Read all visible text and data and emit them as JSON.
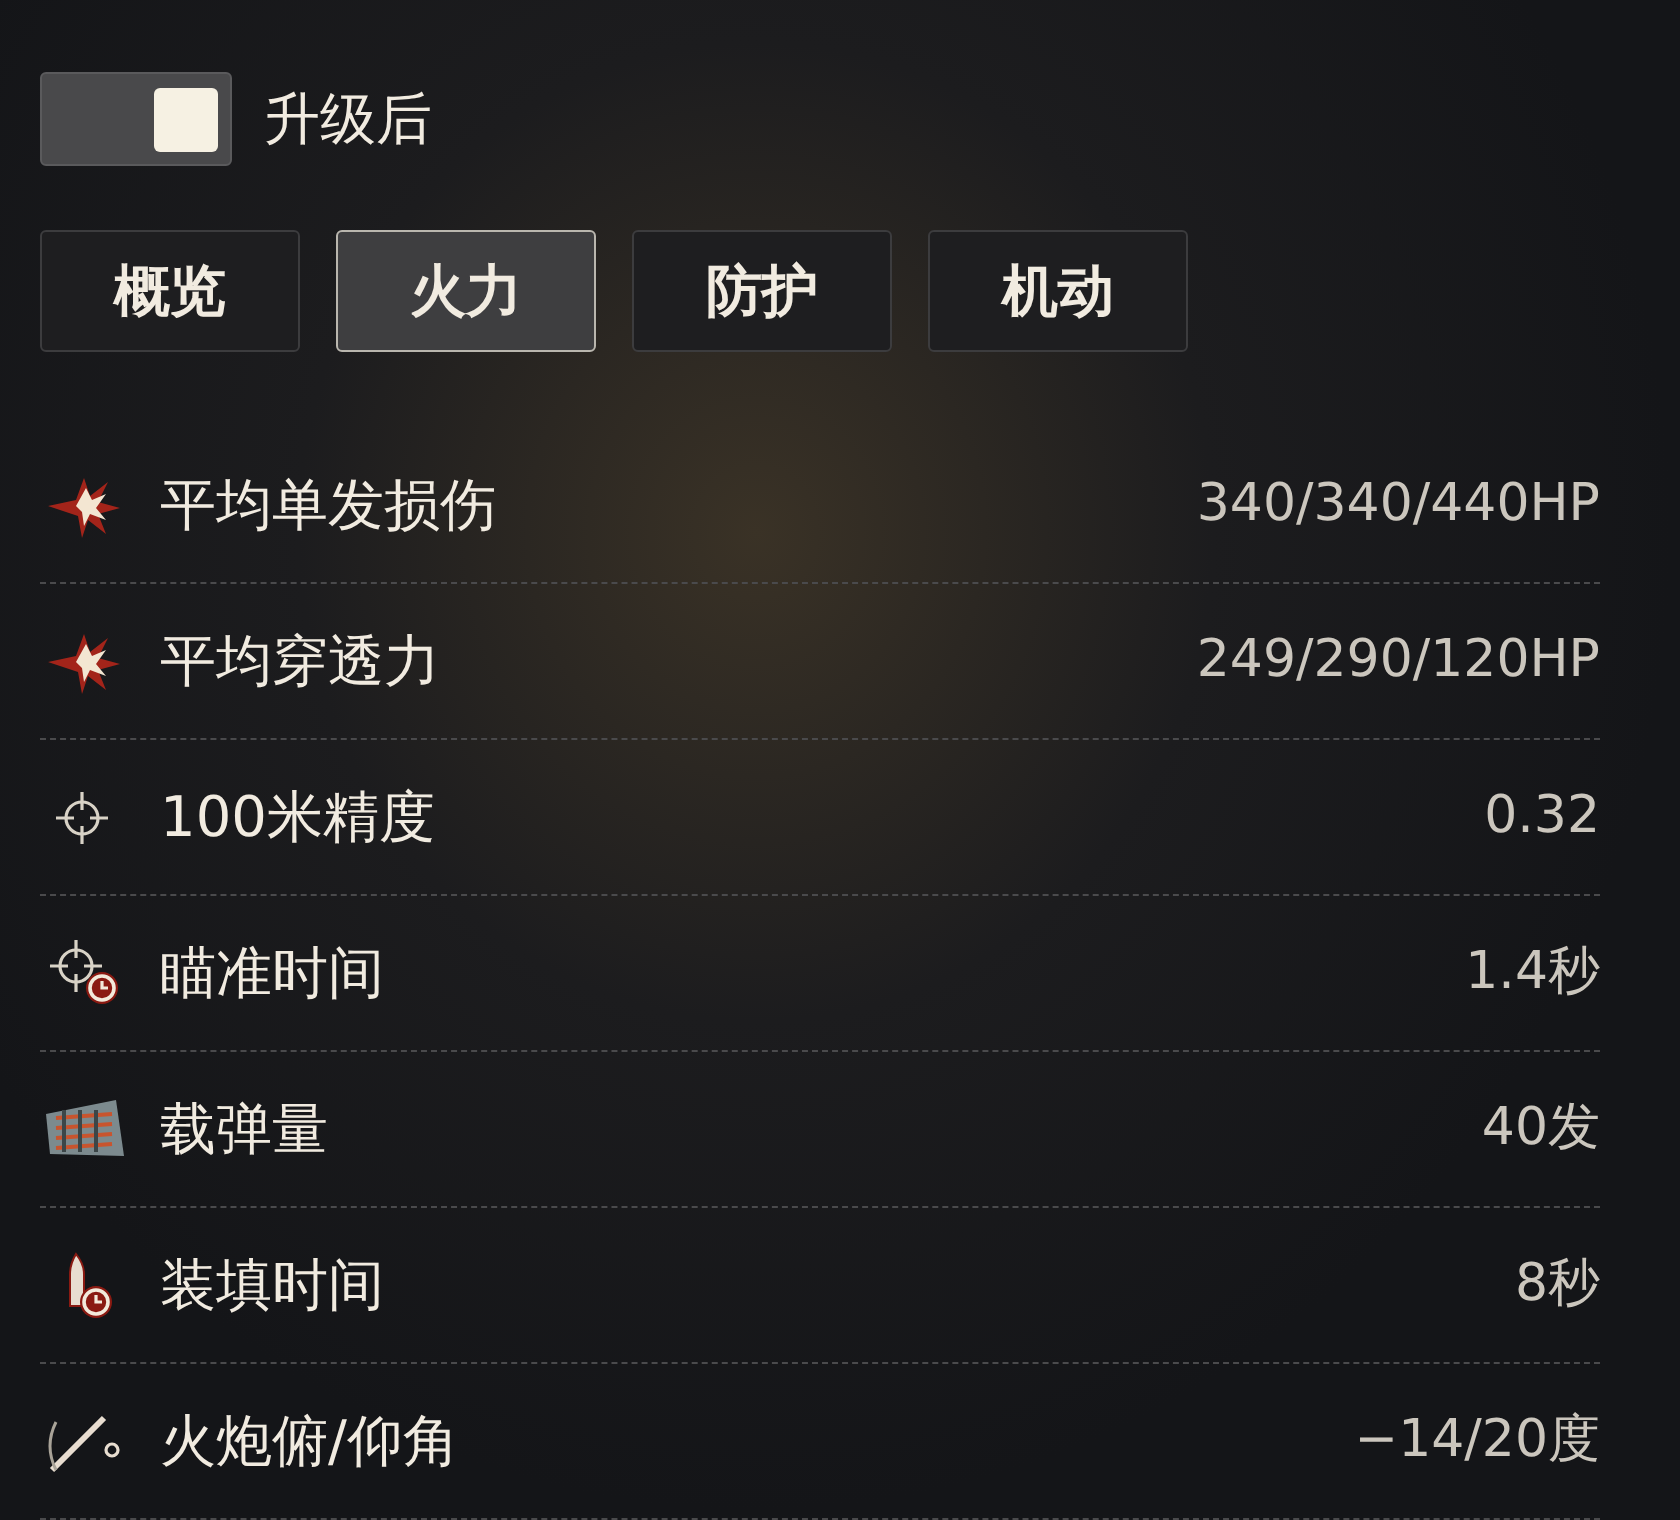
{
  "toggle": {
    "label": "升级后",
    "on": true
  },
  "tabs": [
    {
      "label": "概览",
      "selected": false
    },
    {
      "label": "火力",
      "selected": true
    },
    {
      "label": "防护",
      "selected": false
    },
    {
      "label": "机动",
      "selected": false
    }
  ],
  "stats": [
    {
      "kind": "burst",
      "label": "平均单发损伤",
      "value": "340/340/440HP"
    },
    {
      "kind": "burst",
      "label": "平均穿透力",
      "value": "249/290/120HP"
    },
    {
      "kind": "crosshair",
      "label": "100米精度",
      "value": "0.32"
    },
    {
      "kind": "aim-time",
      "label": "瞄准时间",
      "value": "1.4秒"
    },
    {
      "kind": "ammo",
      "label": "载弹量",
      "value": "40发"
    },
    {
      "kind": "reload",
      "label": "装填时间",
      "value": "8秒"
    },
    {
      "kind": "elevation",
      "label": "火炮俯/仰角",
      "value": "−14/20度"
    }
  ]
}
